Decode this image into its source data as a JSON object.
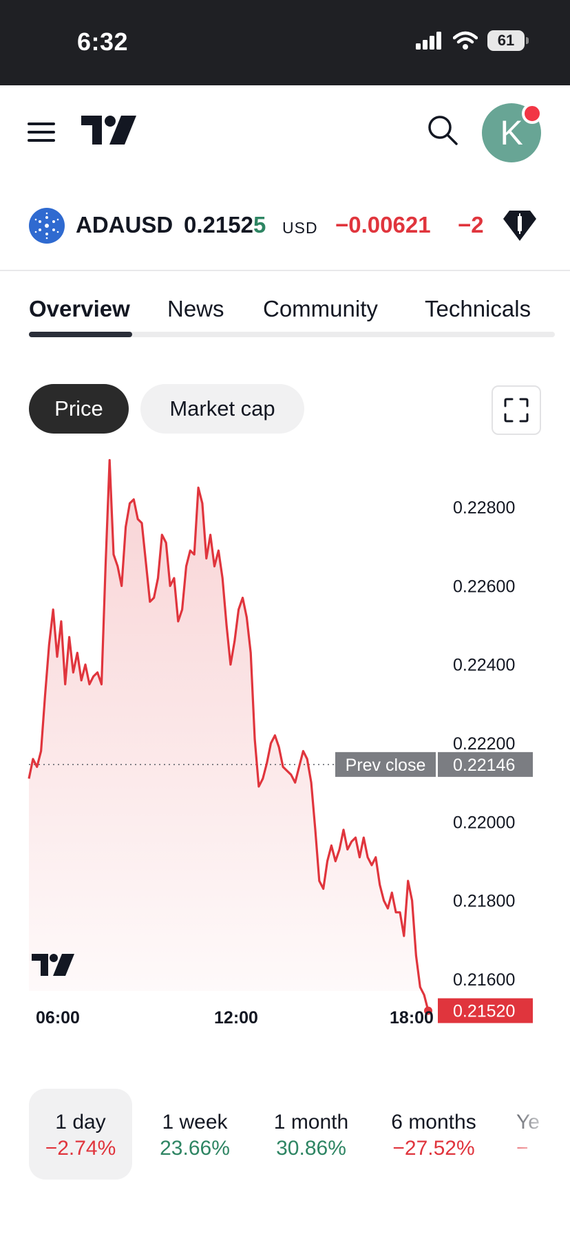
{
  "status_bar": {
    "time": "6:32",
    "battery": "61"
  },
  "symbol": {
    "name": "ADAUSD",
    "price_main": "0.2152",
    "price_last_digit": "5",
    "currency": "USD",
    "change": "−0.00621",
    "change_pct": "−2"
  },
  "tabs": [
    "Overview",
    "News",
    "Community",
    "Technicals"
  ],
  "chart_toggle": {
    "price": "Price",
    "market_cap": "Market cap"
  },
  "chart_data": {
    "type": "area",
    "x_ticks": [
      "06:00",
      "12:00",
      "18:00"
    ],
    "y_ticks": [
      "0.22800",
      "0.22600",
      "0.22400",
      "0.22200",
      "0.22000",
      "0.21800",
      "0.21600"
    ],
    "ylim": [
      0.215,
      0.229
    ],
    "prev_close": {
      "label": "Prev close",
      "value": 0.22146,
      "value_text": "0.22146"
    },
    "last": {
      "value": 0.2152,
      "value_text": "0.21520"
    },
    "values": [
      0.2211,
      0.2216,
      0.2214,
      0.2218,
      0.2232,
      0.2245,
      0.2254,
      0.2242,
      0.2251,
      0.2235,
      0.2247,
      0.2238,
      0.2243,
      0.2236,
      0.224,
      0.2235,
      0.2237,
      0.2238,
      0.2235,
      0.2265,
      0.2292,
      0.2268,
      0.2265,
      0.226,
      0.2275,
      0.2281,
      0.2282,
      0.2277,
      0.2276,
      0.2266,
      0.2256,
      0.2257,
      0.2262,
      0.2273,
      0.2271,
      0.226,
      0.2262,
      0.2251,
      0.2254,
      0.2265,
      0.2269,
      0.2268,
      0.2285,
      0.2281,
      0.2267,
      0.2273,
      0.2265,
      0.2269,
      0.2262,
      0.225,
      0.224,
      0.2246,
      0.2254,
      0.2257,
      0.2252,
      0.2243,
      0.2221,
      0.2209,
      0.2211,
      0.2215,
      0.222,
      0.2222,
      0.2219,
      0.2214,
      0.2213,
      0.2212,
      0.221,
      0.2214,
      0.2218,
      0.2216,
      0.221,
      0.2198,
      0.2185,
      0.2183,
      0.219,
      0.2194,
      0.219,
      0.2193,
      0.2198,
      0.2193,
      0.2195,
      0.2196,
      0.2191,
      0.2196,
      0.2191,
      0.2189,
      0.2191,
      0.2184,
      0.218,
      0.2178,
      0.2182,
      0.2177,
      0.2177,
      0.2171,
      0.2185,
      0.218,
      0.2166,
      0.2158,
      0.2156,
      0.2152
    ],
    "line_color": "#e0353d"
  },
  "periods": [
    {
      "label": "1 day",
      "value": "−2.74%",
      "trend": "neg"
    },
    {
      "label": "1 week",
      "value": "23.66%",
      "trend": "pos"
    },
    {
      "label": "1 month",
      "value": "30.86%",
      "trend": "pos"
    },
    {
      "label": "6 months",
      "value": "−27.52%",
      "trend": "neg"
    },
    {
      "label": "Ye",
      "value": "−",
      "trend": "neg"
    }
  ]
}
